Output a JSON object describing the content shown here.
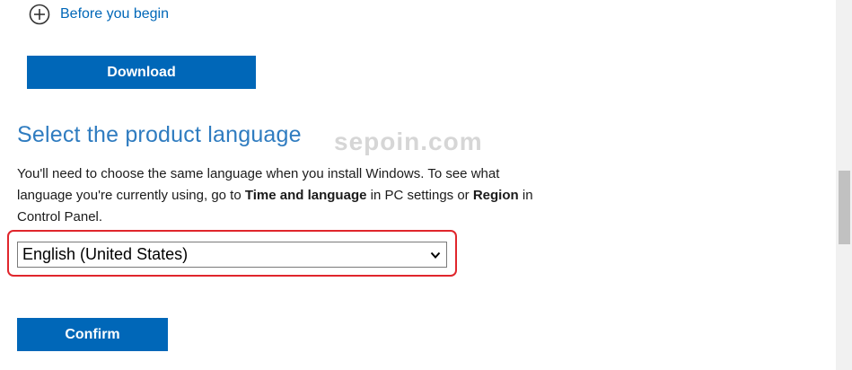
{
  "before_you_begin": {
    "label": "Before you begin",
    "icon": "plus-circle-icon"
  },
  "download_button": {
    "label": "Download"
  },
  "language_section": {
    "heading": "Select the product language",
    "description": {
      "part1": "You'll need to choose the same language when you install Windows. To see what language you're currently using, go to ",
      "bold1": "Time and language",
      "part2": " in PC settings or ",
      "bold2": "Region",
      "part3": " in Control Panel."
    },
    "select": {
      "selected_value": "English (United States)",
      "icon": "chevron-down-icon"
    },
    "highlight_color": "#e0262c"
  },
  "confirm_button": {
    "label": "Confirm"
  },
  "watermark": {
    "text": "sepoin.com"
  },
  "colors": {
    "accent": "#0067b8",
    "heading": "#2f7cc0",
    "text": "#1b1b1b"
  }
}
